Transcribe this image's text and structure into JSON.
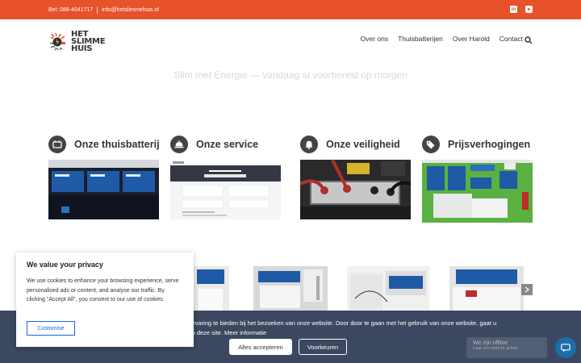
{
  "topbar": {
    "phone": "Bel: 088-4041717",
    "email": "info@hetslimmehuis.nl",
    "social": [
      "linkedin-icon",
      "youtube-icon"
    ],
    "color": "#e8522a"
  },
  "logo": {
    "line1": "HET",
    "line2": "SLIMME",
    "line3": "HUIS"
  },
  "nav": {
    "items": [
      "Over ons",
      "Thuisbatterijen",
      "Over Harold",
      "Contact"
    ],
    "search_icon": "search-icon"
  },
  "hero": {
    "tagline": "Slim met Energie — vandaag al voorbereid op morgen"
  },
  "features": [
    {
      "title": "Onze thuisbatterij",
      "icon": "battery-icon"
    },
    {
      "title": "Onze service",
      "icon": "service-bell-icon"
    },
    {
      "title": "Onze veiligheid",
      "icon": "alarm-bell-icon"
    },
    {
      "title": "Prijsverhogingen",
      "icon": "price-tags-icon"
    }
  ],
  "gallery": {
    "arrow_icon": "chevron-right-icon"
  },
  "privacy": {
    "title": "We value your privacy",
    "text": "We use cookies to enhance your browsing experience, serve personalised ads or content, and analyse our traffic. By clicking \"Accept All\", you consent to our use of cookies.",
    "button": "Customise"
  },
  "cookie_bar": {
    "text": "We gebruiken cookies om u de best mogelijke ervaring te bieden bij het bezoeken van onze website. Door door te gaan met het gebruik van onze website, gaat u impliciet akkoord met het gebruik van cookies op deze site.",
    "link": "Meer informatie",
    "accept": "Alles accepteren",
    "prefs": "Voorkeuren"
  },
  "chat": {
    "status": "We zijn offline",
    "sub": "Laat een bericht achter",
    "icon": "chat-icon"
  },
  "colors": {
    "accent": "#e8522a",
    "cookie_bar": "#2c3a54",
    "privacy_button": "#1863dc",
    "chat": "#1b6ea8"
  }
}
